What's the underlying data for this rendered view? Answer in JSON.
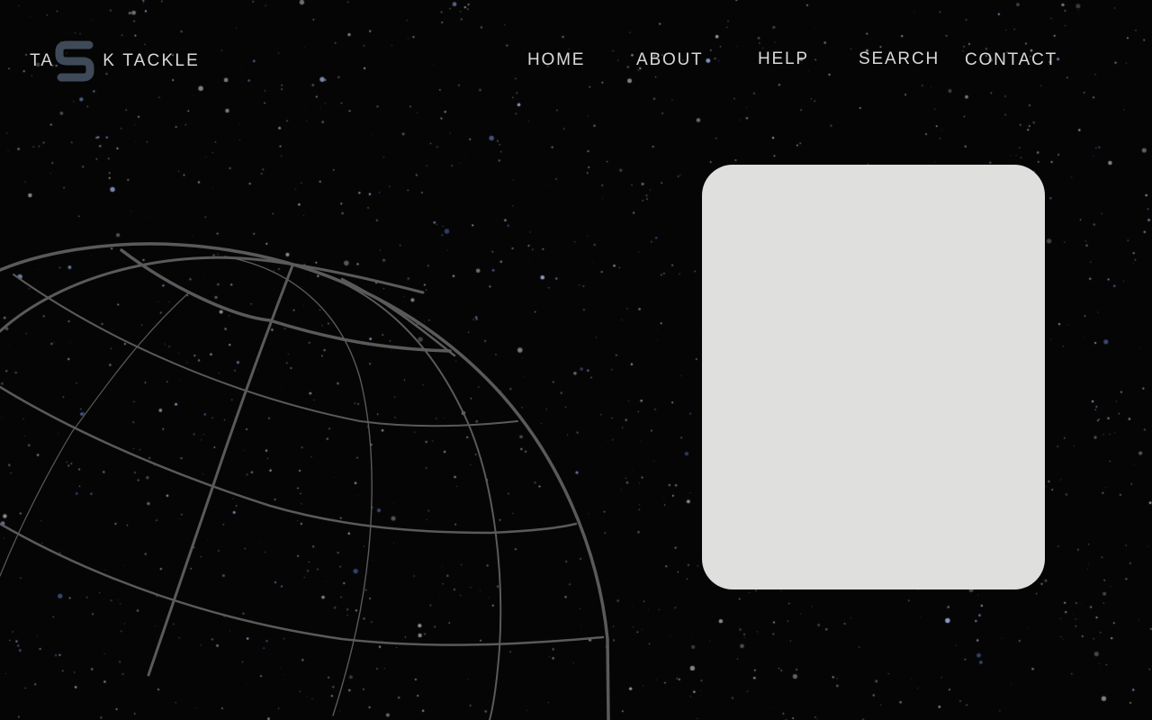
{
  "brand": {
    "prefix": "TA",
    "icon": "s-logo-icon",
    "suffix": "K TACKLE",
    "icon_color": "#3f4a58"
  },
  "nav": {
    "home": "HOME",
    "about": "ABOUT",
    "help": "HELP",
    "search": "SEARCH",
    "contact": "CONTACT"
  },
  "colors": {
    "background": "#050505",
    "globe_lines": "#5a5a5a",
    "card": "#dfdfdd",
    "nav_text": "#d9d9d9"
  },
  "hero": {
    "globe_icon": "wireframe-globe-icon",
    "card": "blank-content-card"
  }
}
